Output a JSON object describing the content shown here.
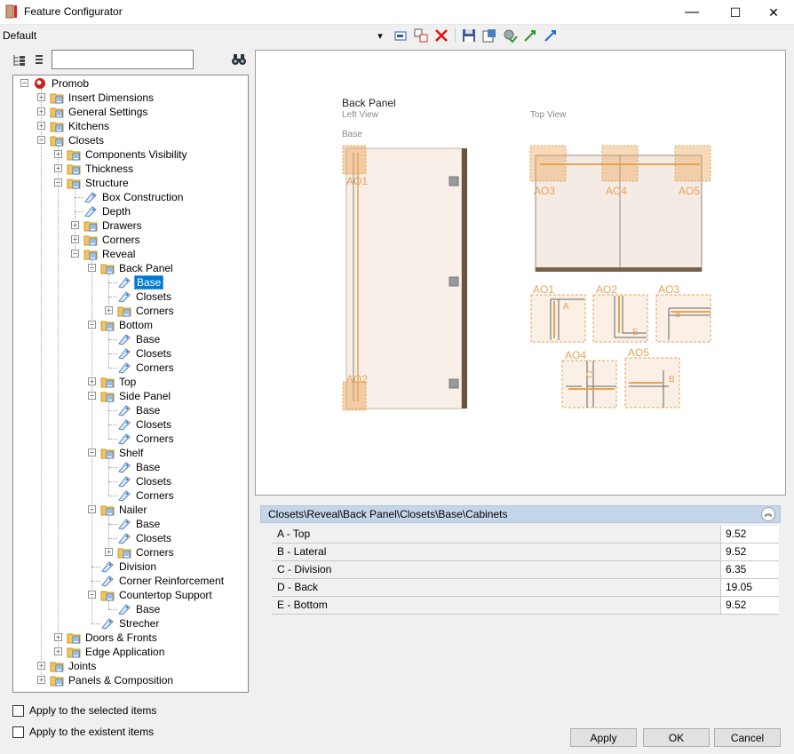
{
  "window": {
    "title": "Feature Configurator",
    "minimize": "—",
    "maximize": "☐",
    "close": "✕"
  },
  "toolbar": {
    "profile": "Default",
    "dropdown": "▾"
  },
  "tree": {
    "nodes": [
      {
        "label": "Promob",
        "type": "root",
        "depth": 0,
        "exp": "-"
      },
      {
        "label": "Insert Dimensions",
        "type": "folder",
        "depth": 1,
        "exp": "+"
      },
      {
        "label": "General Settings",
        "type": "folder",
        "depth": 1,
        "exp": "+"
      },
      {
        "label": "Kitchens",
        "type": "folder",
        "depth": 1,
        "exp": "+"
      },
      {
        "label": "Closets",
        "type": "folder",
        "depth": 1,
        "exp": "-"
      },
      {
        "label": "Components Visibility",
        "type": "folder",
        "depth": 2,
        "exp": "+"
      },
      {
        "label": "Thickness",
        "type": "folder",
        "depth": 2,
        "exp": "+"
      },
      {
        "label": "Structure",
        "type": "folder",
        "depth": 2,
        "exp": "-"
      },
      {
        "label": "Box Construction",
        "type": "tag",
        "depth": 3,
        "exp": ""
      },
      {
        "label": "Depth",
        "type": "tag",
        "depth": 3,
        "exp": ""
      },
      {
        "label": "Drawers",
        "type": "folder",
        "depth": 3,
        "exp": "+"
      },
      {
        "label": "Corners",
        "type": "folder",
        "depth": 3,
        "exp": "+"
      },
      {
        "label": "Reveal",
        "type": "folder",
        "depth": 3,
        "exp": "-"
      },
      {
        "label": "Back Panel",
        "type": "folder",
        "depth": 4,
        "exp": "-"
      },
      {
        "label": "Base",
        "type": "tag",
        "depth": 5,
        "exp": "",
        "selected": true
      },
      {
        "label": "Closets",
        "type": "tag",
        "depth": 5,
        "exp": ""
      },
      {
        "label": "Corners",
        "type": "folder",
        "depth": 5,
        "exp": "+"
      },
      {
        "label": "Bottom",
        "type": "folder",
        "depth": 4,
        "exp": "-"
      },
      {
        "label": "Base",
        "type": "tag",
        "depth": 5,
        "exp": ""
      },
      {
        "label": "Closets",
        "type": "tag",
        "depth": 5,
        "exp": ""
      },
      {
        "label": "Corners",
        "type": "tag",
        "depth": 5,
        "exp": ""
      },
      {
        "label": "Top",
        "type": "folder",
        "depth": 4,
        "exp": "+"
      },
      {
        "label": "Side Panel",
        "type": "folder",
        "depth": 4,
        "exp": "-"
      },
      {
        "label": "Base",
        "type": "tag",
        "depth": 5,
        "exp": ""
      },
      {
        "label": "Closets",
        "type": "tag",
        "depth": 5,
        "exp": ""
      },
      {
        "label": "Corners",
        "type": "tag",
        "depth": 5,
        "exp": ""
      },
      {
        "label": "Shelf",
        "type": "folder",
        "depth": 4,
        "exp": "-"
      },
      {
        "label": "Base",
        "type": "tag",
        "depth": 5,
        "exp": ""
      },
      {
        "label": "Closets",
        "type": "tag",
        "depth": 5,
        "exp": ""
      },
      {
        "label": "Corners",
        "type": "tag",
        "depth": 5,
        "exp": ""
      },
      {
        "label": "Nailer",
        "type": "folder",
        "depth": 4,
        "exp": "-"
      },
      {
        "label": "Base",
        "type": "tag",
        "depth": 5,
        "exp": ""
      },
      {
        "label": "Closets",
        "type": "tag",
        "depth": 5,
        "exp": ""
      },
      {
        "label": "Corners",
        "type": "folder",
        "depth": 5,
        "exp": "+"
      },
      {
        "label": "Division",
        "type": "tag",
        "depth": 4,
        "exp": ""
      },
      {
        "label": "Corner Reinforcement",
        "type": "tag",
        "depth": 4,
        "exp": ""
      },
      {
        "label": "Countertop Support",
        "type": "folder",
        "depth": 4,
        "exp": "-"
      },
      {
        "label": "Base",
        "type": "tag",
        "depth": 5,
        "exp": ""
      },
      {
        "label": "Strecher",
        "type": "tag",
        "depth": 4,
        "exp": ""
      },
      {
        "label": "Doors & Fronts",
        "type": "folder",
        "depth": 2,
        "exp": "+"
      },
      {
        "label": "Edge Application",
        "type": "folder",
        "depth": 2,
        "exp": "+"
      },
      {
        "label": "Joints",
        "type": "folder",
        "depth": 1,
        "exp": "+"
      },
      {
        "label": "Panels & Composition",
        "type": "folder",
        "depth": 1,
        "exp": "+"
      }
    ]
  },
  "preview": {
    "title": "Back Panel",
    "left_view": "Left View",
    "top_view": "Top View",
    "base": "Base",
    "markers": {
      "ao1": "AO1",
      "ao2": "AO2",
      "ao3": "AO3",
      "ao4": "AO4",
      "ao5": "AO5"
    },
    "details": {
      "a": "A",
      "b": "B",
      "c": "C",
      "e": "E"
    }
  },
  "properties": {
    "path": "Closets\\Reveal\\Back Panel\\Closets\\Base\\Cabinets",
    "collapse": "︽",
    "rows": [
      {
        "name": "A - Top",
        "value": "9.52"
      },
      {
        "name": "B - Lateral",
        "value": "9.52"
      },
      {
        "name": "C - Division",
        "value": "6.35"
      },
      {
        "name": "D - Back",
        "value": "19.05"
      },
      {
        "name": "E - Bottom",
        "value": "9.52"
      }
    ]
  },
  "options": {
    "apply_selected": "Apply to the selected items",
    "apply_existent": "Apply to the existent items"
  },
  "buttons": {
    "apply": "Apply",
    "ok": "OK",
    "cancel": "Cancel"
  },
  "colors": {
    "accent": "#e8a251",
    "wood": "#7a6249",
    "selection": "#0078d7"
  }
}
